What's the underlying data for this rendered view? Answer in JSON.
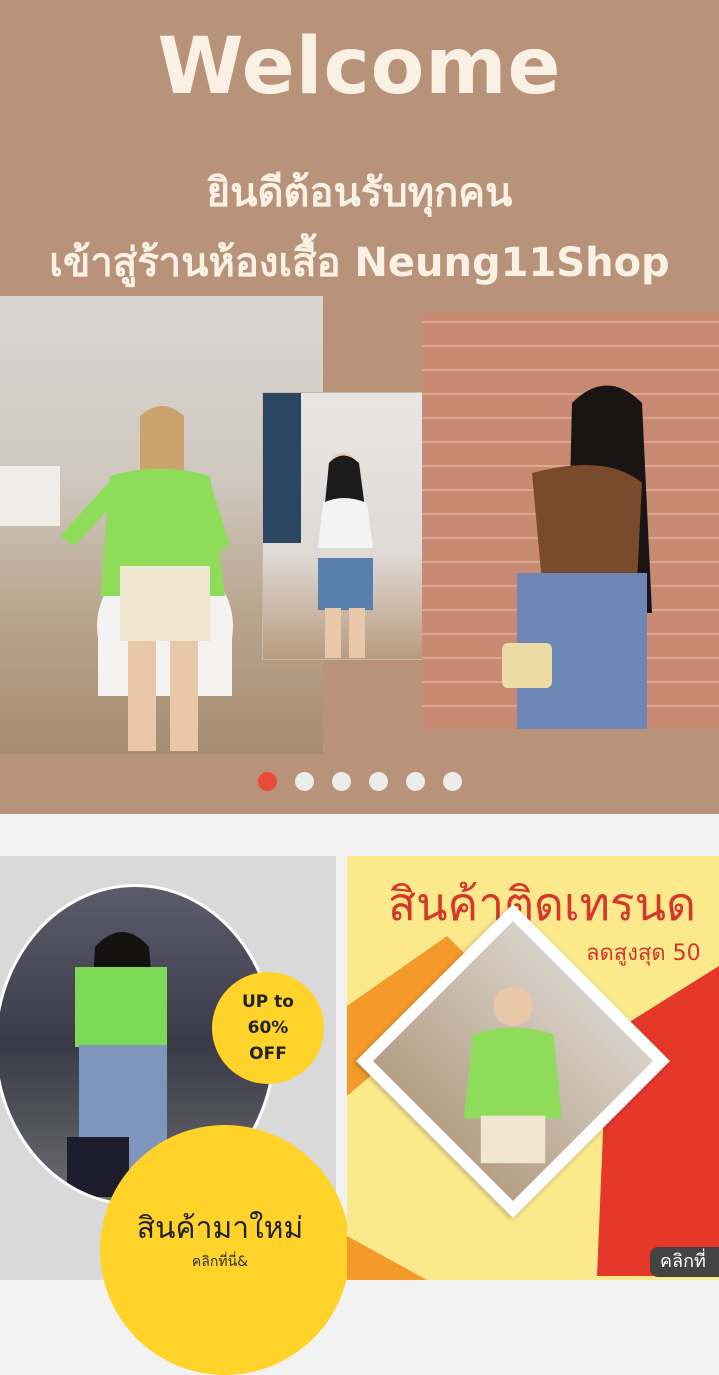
{
  "banner": {
    "title": "Welcome",
    "line1": "ยินดีต้อนรับทุกคน",
    "line2": "เข้าสู่ร้านห้องเสื้อ Neung11Shop",
    "slide_count": 6,
    "active_slide": 1
  },
  "promo_new": {
    "badge_line1": "UP to",
    "badge_line2": "60%",
    "badge_line3": "OFF",
    "title": "สินค้ามาใหม่",
    "subtitle": "คลิกที่นี่&"
  },
  "promo_trend": {
    "title": "สินค้าติดเทรนด",
    "subtitle": "ลดสูงสุด 50",
    "click_label": "คลิกที่"
  },
  "colors": {
    "banner_bg": "#b8937a",
    "accent_red": "#e84b3a",
    "yellow": "#ffd32a"
  }
}
